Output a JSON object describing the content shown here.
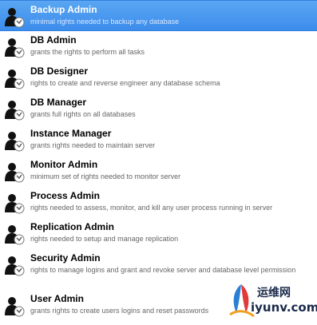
{
  "roles": [
    {
      "name": "Backup Admin",
      "description": "minimal rights needed to backup any database",
      "selected": true
    },
    {
      "name": "DB Admin",
      "description": "grants the rights to perform all tasks",
      "selected": false
    },
    {
      "name": "DB Designer",
      "description": "rights to create and reverse engineer any database schema",
      "selected": false
    },
    {
      "name": "DB Manager",
      "description": "grants full rights on all databases",
      "selected": false
    },
    {
      "name": "Instance Manager",
      "description": "grants rights needed to maintain server",
      "selected": false
    },
    {
      "name": "Monitor Admin",
      "description": "minimum set of rights needed to monitor server",
      "selected": false
    },
    {
      "name": "Process Admin",
      "description": "rights needed to assess, monitor, and kill any user process running in server",
      "selected": false
    },
    {
      "name": "Replication Admin",
      "description": "rights needed to setup and manage replication",
      "selected": false
    },
    {
      "name": "Security Admin",
      "description": "rights to manage logins and grant and revoke server and database level permission",
      "selected": false
    },
    {
      "name": "User Admin",
      "description": "grants rights to create users logins and reset passwords",
      "selected": false
    }
  ],
  "icon": "user-role-icon",
  "colors": {
    "selection": "#3c8cec",
    "title": "#000000",
    "description": "#666666"
  },
  "watermark": {
    "chinese_text": "运维网",
    "domain": "iyunv.com"
  }
}
